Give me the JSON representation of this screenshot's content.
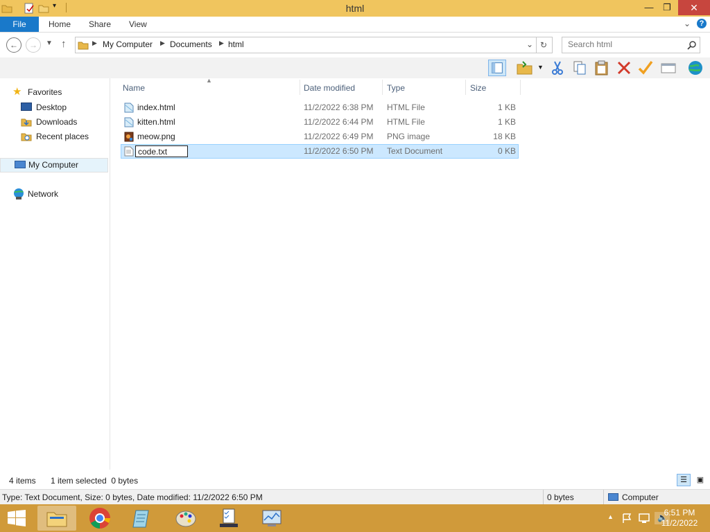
{
  "window": {
    "title": "html"
  },
  "ribbon": {
    "tabs": [
      "File",
      "Home",
      "Share",
      "View"
    ]
  },
  "address": {
    "crumbs": [
      "My Computer",
      "Documents",
      "html"
    ],
    "search_placeholder": "Search html"
  },
  "nav": {
    "favorites": "Favorites",
    "favorite_items": [
      "Desktop",
      "Downloads",
      "Recent places"
    ],
    "computer": "My Computer",
    "network": "Network"
  },
  "columns": {
    "name": "Name",
    "date": "Date modified",
    "type": "Type",
    "size": "Size"
  },
  "files": [
    {
      "name": "index.html",
      "date": "11/2/2022 6:38 PM",
      "type": "HTML File",
      "size": "1 KB",
      "icon": "html-file-icon"
    },
    {
      "name": "kitten.html",
      "date": "11/2/2022 6:44 PM",
      "type": "HTML File",
      "size": "1 KB",
      "icon": "html-file-icon"
    },
    {
      "name": "meow.png",
      "date": "11/2/2022 6:49 PM",
      "type": "PNG image",
      "size": "18 KB",
      "icon": "png-image-icon"
    },
    {
      "name": "code.txt",
      "date": "11/2/2022 6:50 PM",
      "type": "Text Document",
      "size": "0 KB",
      "icon": "text-file-icon",
      "selected": true,
      "renaming": true
    }
  ],
  "status": {
    "items": "4 items",
    "selection": "1 item selected  0 bytes"
  },
  "details": {
    "text": "Type: Text Document, Size: 0 bytes, Date modified: 11/2/2022 6:50 PM",
    "size": "0 bytes",
    "location": "Computer"
  },
  "taskbar": {
    "time": "6:51 PM",
    "date": "11/2/2022"
  },
  "colors": {
    "title_bar": "#f0c55e",
    "file_tab": "#1979ca",
    "close": "#c7463e",
    "selection": "#cce8ff",
    "taskbar": "#d09a3a"
  }
}
